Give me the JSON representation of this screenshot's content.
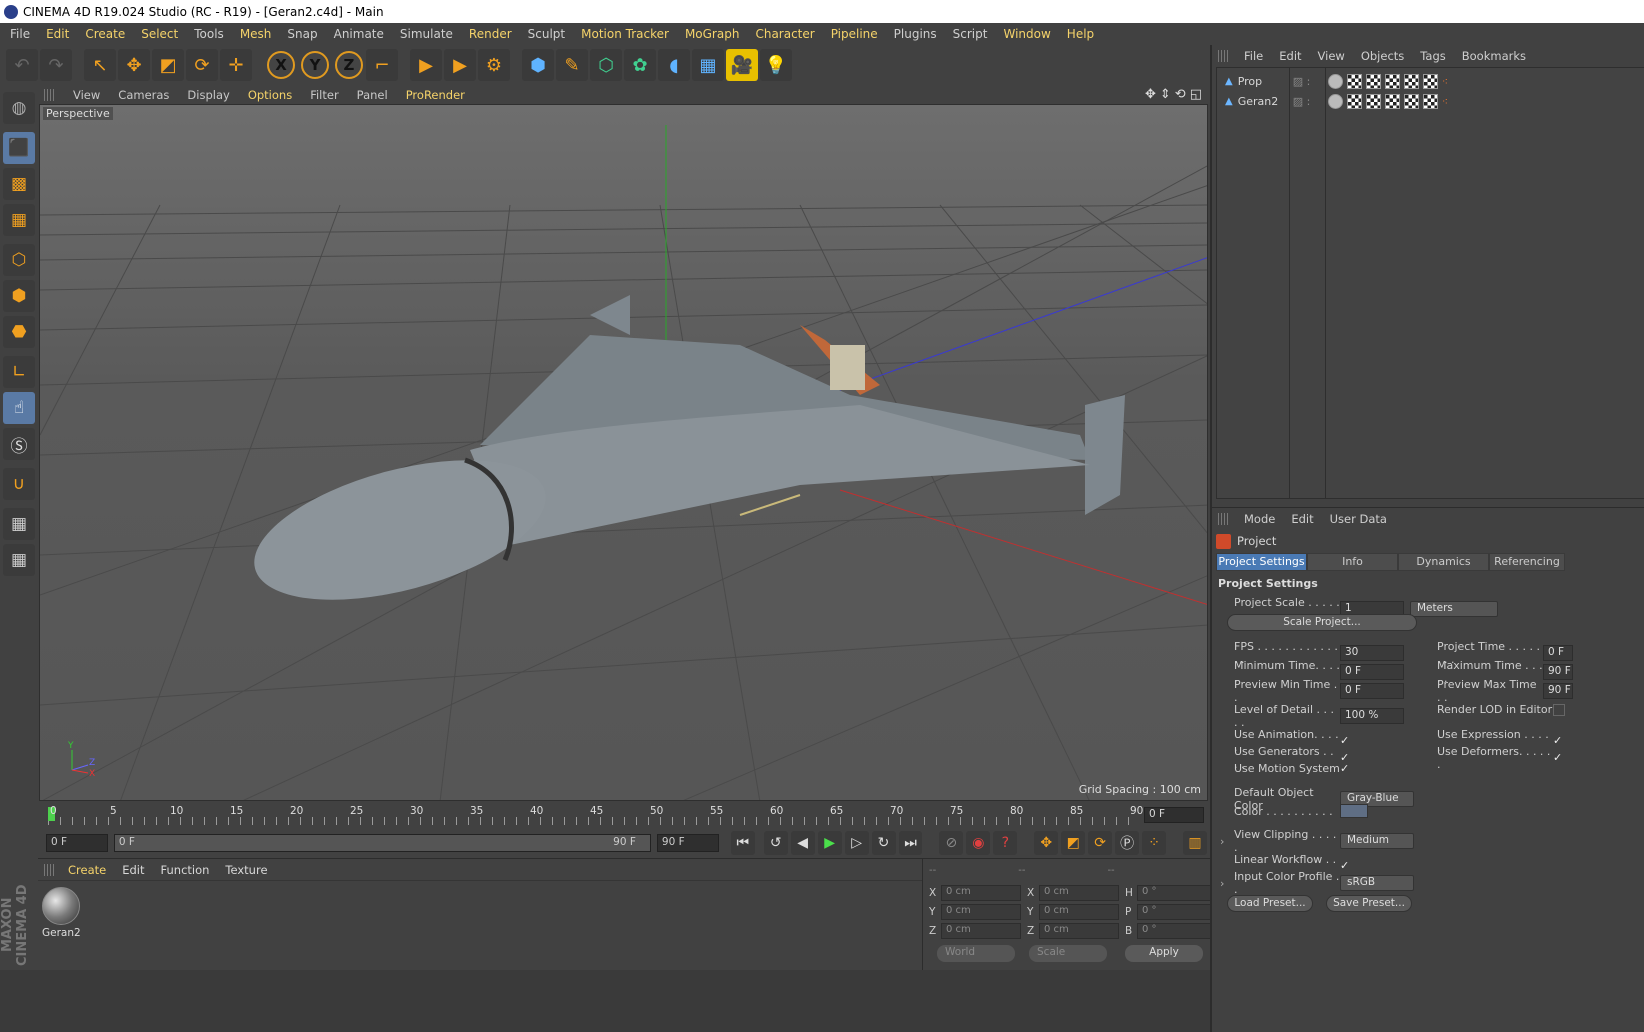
{
  "window": {
    "title": "CINEMA 4D R19.024 Studio (RC - R19) - [Geran2.c4d] - Main"
  },
  "menubar": [
    "File",
    "Edit",
    "Create",
    "Select",
    "Tools",
    "Mesh",
    "Snap",
    "Animate",
    "Simulate",
    "Render",
    "Sculpt",
    "Motion Tracker",
    "MoGraph",
    "Character",
    "Pipeline",
    "Plugins",
    "Script",
    "Window",
    "Help"
  ],
  "menubar_highlight": [
    "Edit",
    "Create",
    "Select",
    "Mesh",
    "Render",
    "Motion Tracker",
    "MoGraph",
    "Character",
    "Pipeline",
    "Window",
    "Help"
  ],
  "toolbar": {
    "icons": [
      "undo-icon",
      "redo-icon",
      "live-select-icon",
      "move-icon",
      "scale-icon",
      "rotate-icon",
      "transform-icon",
      "x-axis-icon",
      "y-axis-icon",
      "z-axis-icon",
      "coordinate-system-icon",
      "render-view-icon",
      "render-picture-viewer-icon",
      "render-settings-icon",
      "cube-primitive-icon",
      "spline-pen-icon",
      "subdivision-surface-icon",
      "array-icon",
      "deformer-icon",
      "floor-environment-icon",
      "camera-icon",
      "light-icon"
    ],
    "axis_labels": [
      "X",
      "Y",
      "Z"
    ]
  },
  "viewport": {
    "menu": [
      "View",
      "Cameras",
      "Display",
      "Options",
      "Filter",
      "Panel",
      "ProRender"
    ],
    "view_name": "Perspective",
    "grid_spacing": "Grid Spacing : 100 cm",
    "axis_gizmo": [
      "Y",
      "Z",
      "X"
    ]
  },
  "timeline": {
    "ticks": [
      "0",
      "5",
      "10",
      "15",
      "20",
      "25",
      "30",
      "35",
      "40",
      "45",
      "50",
      "55",
      "60",
      "65",
      "70",
      "75",
      "80",
      "85",
      "90"
    ],
    "current_frame": "0 F"
  },
  "playback": {
    "start_field": "0 F",
    "range_start": "0 F",
    "range_end": "90 F",
    "end_field": "90 F"
  },
  "material_manager": {
    "menu": [
      "Create",
      "Edit",
      "Function",
      "Texture"
    ],
    "materials": [
      {
        "name": "Geran2"
      }
    ]
  },
  "coordinates": {
    "headers": [
      "--",
      "--",
      "--"
    ],
    "rows": [
      {
        "l1": "X",
        "v1": "0 cm",
        "l2": "X",
        "v2": "0 cm",
        "l3": "H",
        "v3": "0 °"
      },
      {
        "l1": "Y",
        "v1": "0 cm",
        "l2": "Y",
        "v2": "0 cm",
        "l3": "P",
        "v3": "0 °"
      },
      {
        "l1": "Z",
        "v1": "0 cm",
        "l2": "Z",
        "v2": "0 cm",
        "l3": "B",
        "v3": "0 °"
      }
    ],
    "space": "World",
    "mode": "Scale",
    "apply": "Apply"
  },
  "object_manager": {
    "menu": [
      "File",
      "Edit",
      "View",
      "Objects",
      "Tags",
      "Bookmarks"
    ],
    "objects": [
      {
        "name": "Prop"
      },
      {
        "name": "Geran2"
      }
    ]
  },
  "attribute_manager": {
    "menu": [
      "Mode",
      "Edit",
      "User Data"
    ],
    "title": "Project",
    "tabs": [
      "Project Settings",
      "Info",
      "Dynamics",
      "Referencing"
    ],
    "section": "Project Settings",
    "project_scale_label": "Project Scale . . . . . .",
    "project_scale_value": "1",
    "project_scale_unit": "Meters",
    "scale_project_button": "Scale Project...",
    "left_fields": [
      {
        "label": "FPS . . . . . . . . . . . . . .",
        "value": "30"
      },
      {
        "label": "Minimum Time. . . . .",
        "value": "0 F"
      },
      {
        "label": "Preview Min Time . .",
        "value": "0 F"
      }
    ],
    "right_fields": [
      {
        "label": "Project Time . . . . . . . .",
        "value": "0 F"
      },
      {
        "label": "Maximum Time . . . . .",
        "value": "90 F"
      },
      {
        "label": "Preview Max Time . .",
        "value": "90 F"
      }
    ],
    "lod_label": "Level of Detail . . . . .",
    "lod_value": "100 %",
    "render_lod_label": "Render LOD in Editor",
    "checks_left": [
      {
        "label": "Use Animation. . . . .",
        "checked": "✓"
      },
      {
        "label": "Use Generators . . . .",
        "checked": "✓"
      },
      {
        "label": "Use Motion System",
        "checked": "✓"
      }
    ],
    "checks_right": [
      {
        "label": "Use Expression . . . . .",
        "checked": "✓"
      },
      {
        "label": "Use Deformers. . . . . .",
        "checked": "✓"
      }
    ],
    "default_color_label": "Default Object Color",
    "default_color_value": "Gray-Blue",
    "color_label": "Color . . . . . . . . . .",
    "color_swatch": "#5f6e84",
    "view_clipping_label": "View Clipping . . . . .",
    "view_clipping_value": "Medium",
    "linear_workflow_label": "Linear Workflow . . .",
    "linear_workflow_checked": "✓",
    "input_color_label": "Input Color Profile . .",
    "input_color_value": "sRGB",
    "load_preset": "Load Preset...",
    "save_preset": "Save Preset..."
  },
  "brand": "MAXON CINEMA 4D"
}
